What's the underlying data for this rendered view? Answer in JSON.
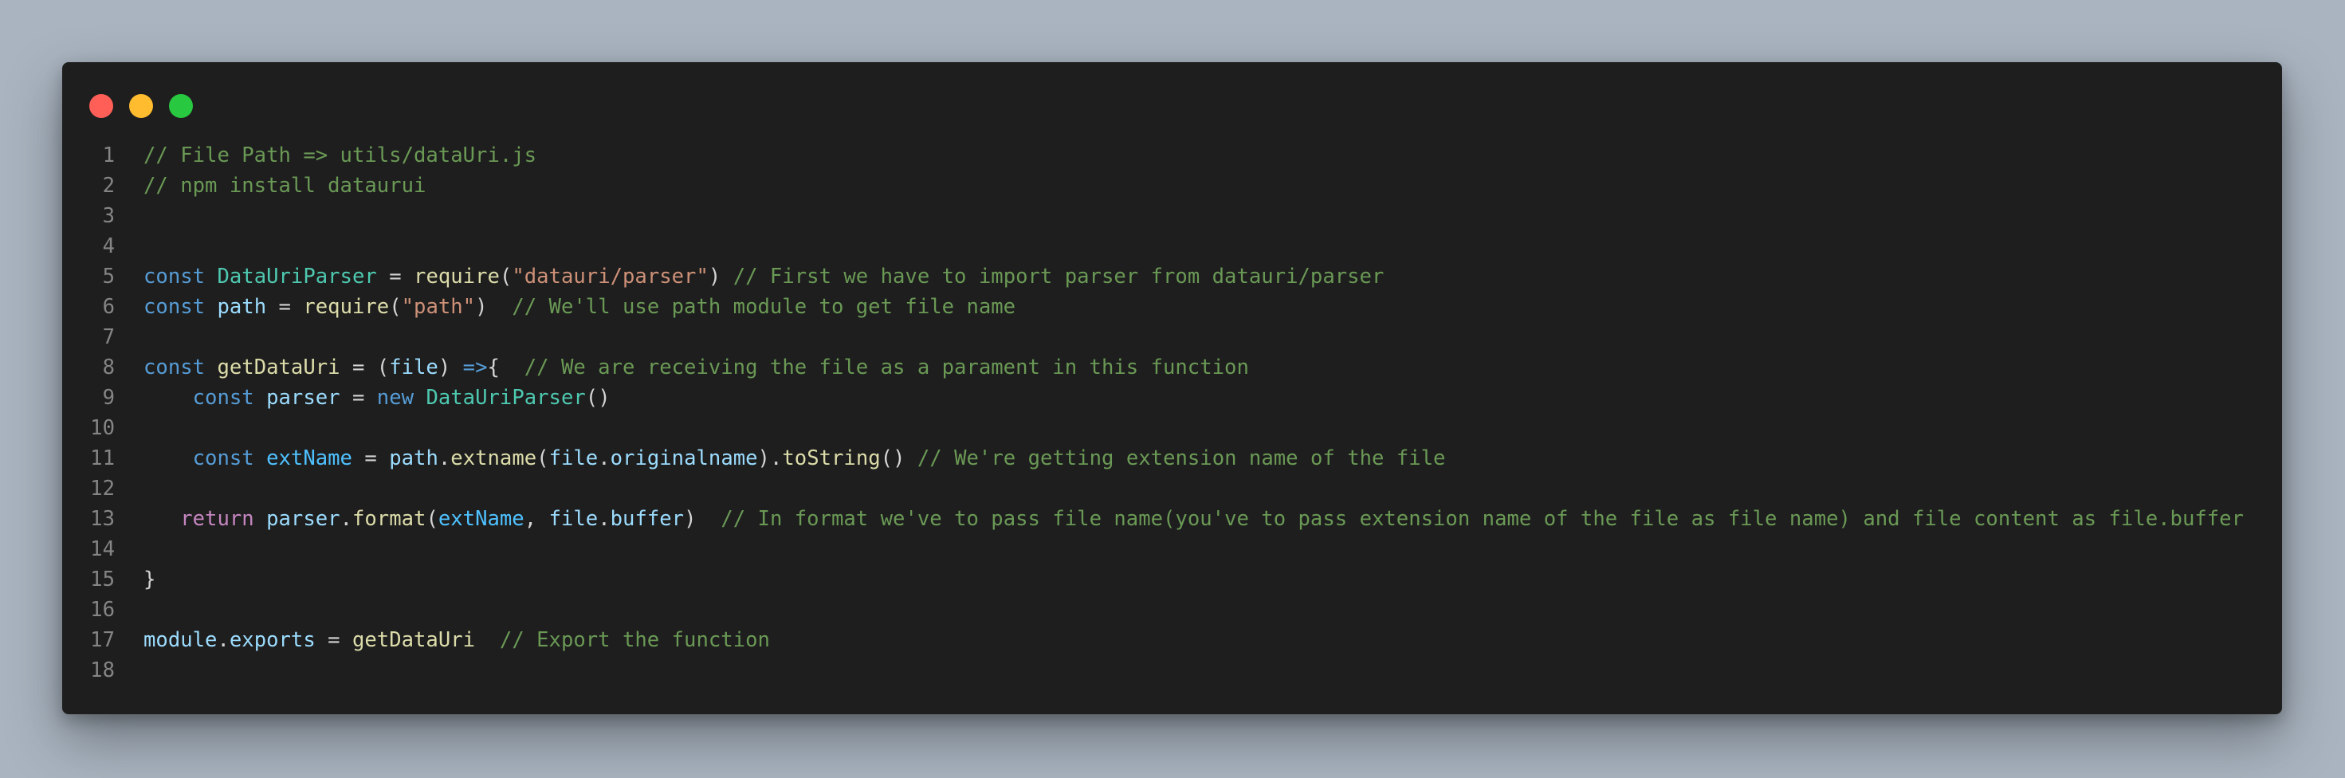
{
  "window": {
    "controls": [
      "close",
      "minimize",
      "maximize"
    ]
  },
  "colors": {
    "background": "#a9b4c0",
    "editor": "#1e1e1e",
    "comment": "#6a9955",
    "keyword": "#569cd6",
    "control": "#c586c0",
    "class": "#4ec9b0",
    "function": "#dcdcaa",
    "string": "#ce9178",
    "variable": "#9cdcfe",
    "constant": "#4fc1ff",
    "plain": "#d4d4d4",
    "line_number": "#858585"
  },
  "code": {
    "language": "javascript",
    "lines": [
      {
        "n": "1",
        "tokens": [
          [
            "comment",
            "// File Path => utils/dataUri.js"
          ]
        ]
      },
      {
        "n": "2",
        "tokens": [
          [
            "comment",
            "// npm install dataurui"
          ]
        ]
      },
      {
        "n": "3",
        "tokens": []
      },
      {
        "n": "4",
        "tokens": []
      },
      {
        "n": "5",
        "tokens": [
          [
            "keyword",
            "const"
          ],
          [
            "plain",
            " "
          ],
          [
            "class",
            "DataUriParser"
          ],
          [
            "plain",
            " = "
          ],
          [
            "func",
            "require"
          ],
          [
            "plain",
            "("
          ],
          [
            "string",
            "\"datauri/parser\""
          ],
          [
            "plain",
            ") "
          ],
          [
            "comment",
            "// First we have to import parser from datauri/parser"
          ]
        ]
      },
      {
        "n": "6",
        "tokens": [
          [
            "keyword",
            "const"
          ],
          [
            "plain",
            " "
          ],
          [
            "var",
            "path"
          ],
          [
            "plain",
            " = "
          ],
          [
            "func",
            "require"
          ],
          [
            "plain",
            "("
          ],
          [
            "string",
            "\"path\""
          ],
          [
            "plain",
            ")  "
          ],
          [
            "comment",
            "// We'll use path module to get file name"
          ]
        ]
      },
      {
        "n": "7",
        "tokens": []
      },
      {
        "n": "8",
        "tokens": [
          [
            "keyword",
            "const"
          ],
          [
            "plain",
            " "
          ],
          [
            "func",
            "getDataUri"
          ],
          [
            "plain",
            " = ("
          ],
          [
            "var",
            "file"
          ],
          [
            "plain",
            ") "
          ],
          [
            "keyword",
            "=>"
          ],
          [
            "plain",
            "{  "
          ],
          [
            "comment",
            "// We are receiving the file as a parament in this function"
          ]
        ]
      },
      {
        "n": "9",
        "tokens": [
          [
            "plain",
            "    "
          ],
          [
            "keyword",
            "const"
          ],
          [
            "plain",
            " "
          ],
          [
            "var",
            "parser"
          ],
          [
            "plain",
            " = "
          ],
          [
            "keyword",
            "new"
          ],
          [
            "plain",
            " "
          ],
          [
            "class",
            "DataUriParser"
          ],
          [
            "plain",
            "()"
          ]
        ]
      },
      {
        "n": "10",
        "tokens": []
      },
      {
        "n": "11",
        "tokens": [
          [
            "plain",
            "    "
          ],
          [
            "keyword",
            "const"
          ],
          [
            "plain",
            " "
          ],
          [
            "const",
            "extName"
          ],
          [
            "plain",
            " = "
          ],
          [
            "var",
            "path"
          ],
          [
            "plain",
            "."
          ],
          [
            "func",
            "extname"
          ],
          [
            "plain",
            "("
          ],
          [
            "var",
            "file"
          ],
          [
            "plain",
            "."
          ],
          [
            "var",
            "originalname"
          ],
          [
            "plain",
            ")."
          ],
          [
            "func",
            "toString"
          ],
          [
            "plain",
            "() "
          ],
          [
            "comment",
            "// We're getting extension name of the file"
          ]
        ]
      },
      {
        "n": "12",
        "tokens": []
      },
      {
        "n": "13",
        "tokens": [
          [
            "plain",
            "   "
          ],
          [
            "control",
            "return"
          ],
          [
            "plain",
            " "
          ],
          [
            "var",
            "parser"
          ],
          [
            "plain",
            "."
          ],
          [
            "func",
            "format"
          ],
          [
            "plain",
            "("
          ],
          [
            "const",
            "extName"
          ],
          [
            "plain",
            ", "
          ],
          [
            "var",
            "file"
          ],
          [
            "plain",
            "."
          ],
          [
            "var",
            "buffer"
          ],
          [
            "plain",
            ")  "
          ],
          [
            "comment",
            "// In format we've to pass file name(you've to pass extension name of the file as file name) and file content as file.buffer"
          ]
        ]
      },
      {
        "n": "14",
        "tokens": []
      },
      {
        "n": "15",
        "tokens": [
          [
            "plain",
            "}"
          ]
        ]
      },
      {
        "n": "16",
        "tokens": []
      },
      {
        "n": "17",
        "tokens": [
          [
            "var",
            "module"
          ],
          [
            "plain",
            "."
          ],
          [
            "var",
            "exports"
          ],
          [
            "plain",
            " = "
          ],
          [
            "func",
            "getDataUri"
          ],
          [
            "plain",
            "  "
          ],
          [
            "comment",
            "// Export the function"
          ]
        ]
      },
      {
        "n": "18",
        "tokens": []
      }
    ]
  }
}
